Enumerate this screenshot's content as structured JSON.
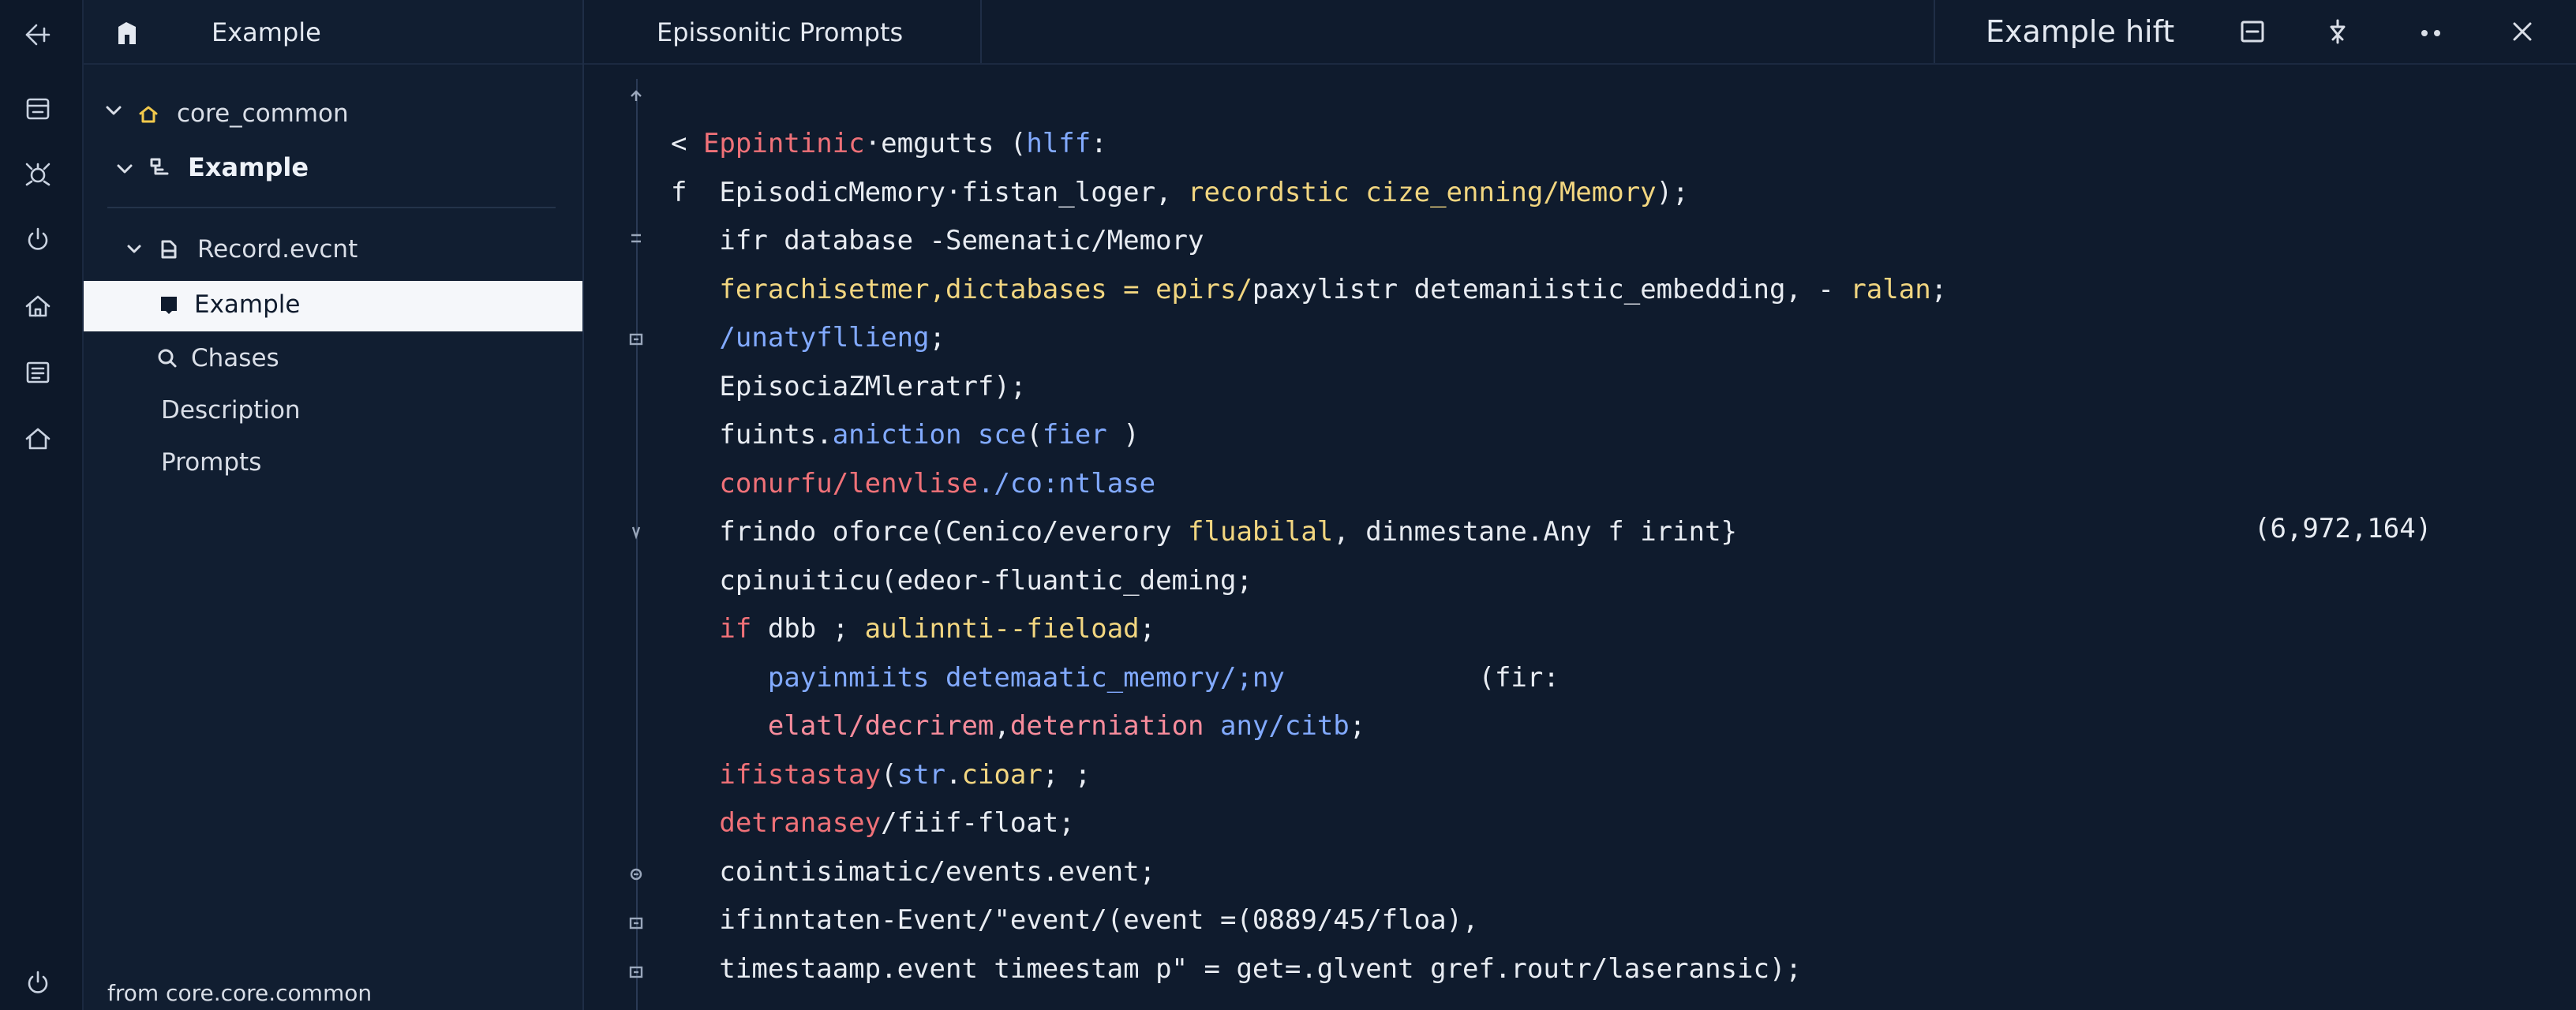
{
  "sidebar": {
    "header_title": "Example",
    "tree": {
      "root_label": "core_common",
      "example_label": "Example",
      "record_label": "Record.evcnt",
      "selected_label": "Example",
      "chases_label": "Chases",
      "description_label": "Description",
      "prompts_label": "Prompts"
    },
    "footer": "from core.core.common"
  },
  "editor": {
    "tab_title": "Epissonitic Prompts",
    "right_title": "Example hift",
    "right_icons": [
      "panel-icon",
      "tool-icon",
      "more-icon",
      "close-icon"
    ],
    "code_lines": [
      [
        [
          "c-def",
          "< "
        ],
        [
          "c-kw",
          "Eppintinic"
        ],
        [
          "c-def",
          "·emgutts ("
        ],
        [
          "c-fn",
          "hlff"
        ],
        [
          "c-def",
          ":"
        ]
      ],
      [
        [
          "c-def",
          "f  EpisodicMemory·fistan_loger, "
        ],
        [
          "c-ty",
          "recordstic cize_enning/Memory"
        ],
        [
          "c-def",
          ");"
        ]
      ],
      [
        [
          "c-def",
          "   ifr database -Semenatic/Memory"
        ]
      ],
      [
        [
          "c-ty",
          "   ferachisetmer,dictabases = epirs/"
        ],
        [
          "c-def",
          "paxylistr detemaniistic_embedding, - "
        ],
        [
          "c-ty",
          "ralan"
        ],
        [
          "c-def",
          ";"
        ]
      ],
      [
        [
          "c-fn",
          "   /unatyfllieng"
        ],
        [
          "c-def",
          ";"
        ]
      ],
      [
        [
          "c-def",
          "   EpisociaZMleratrf);"
        ]
      ],
      [
        [
          "c-def",
          "   fuints."
        ],
        [
          "c-fn",
          "aniction sce"
        ],
        [
          "c-def",
          "("
        ],
        [
          "c-fn",
          "fier"
        ],
        [
          "c-def",
          " )"
        ]
      ],
      [
        [
          "c-kw",
          "   conurfu/lenvlise"
        ],
        [
          "c-fn",
          "./co:ntlase"
        ]
      ],
      [
        [
          "c-def",
          "   frindo oforce(Cenico/everory "
        ],
        [
          "c-ty",
          "fluabilal"
        ],
        [
          "c-def",
          ", dinmestane.Any f irint}"
        ]
      ],
      [
        [
          "c-def",
          "   cpinuiticu(edeor-fluantic_deming;"
        ]
      ],
      [
        [
          "c-kw",
          "   if "
        ],
        [
          "c-def",
          "dbb ; "
        ],
        [
          "c-ty",
          "aulinnti--fieload"
        ],
        [
          "c-def",
          ";"
        ]
      ],
      [
        [
          "c-fn",
          "      payinmiits detemaatic_memory/;ny"
        ],
        [
          "c-def",
          "            (fir:"
        ]
      ],
      [
        [
          "c-def",
          "      "
        ],
        [
          "c-pk",
          "elatl/decrirem"
        ],
        [
          "c-def",
          ","
        ],
        [
          "c-pk",
          "deterniation "
        ],
        [
          "c-fn",
          "any/citb"
        ],
        [
          "c-def",
          ";"
        ]
      ],
      [
        [
          "c-kw",
          "   ifistastay"
        ],
        [
          "c-def",
          "("
        ],
        [
          "c-fn",
          "str"
        ],
        [
          "c-def",
          "."
        ],
        [
          "c-ty",
          "cioar"
        ],
        [
          "c-def",
          "; ;"
        ]
      ],
      [
        [
          "c-kw",
          "   detranasey"
        ],
        [
          "c-def",
          "/fiif-float;"
        ]
      ],
      [
        [
          "c-def",
          "   cointisimatic/events.event;"
        ]
      ],
      [
        [
          "c-def",
          "   ifinntaten-Event/\"event/(event =(0889/45/floa),"
        ]
      ],
      [
        [
          "c-def",
          "   timestaamp.event timeestam p\" = get=.glvent gref.routr/laseransic);"
        ]
      ]
    ],
    "annotation": "(6,972,164)"
  }
}
